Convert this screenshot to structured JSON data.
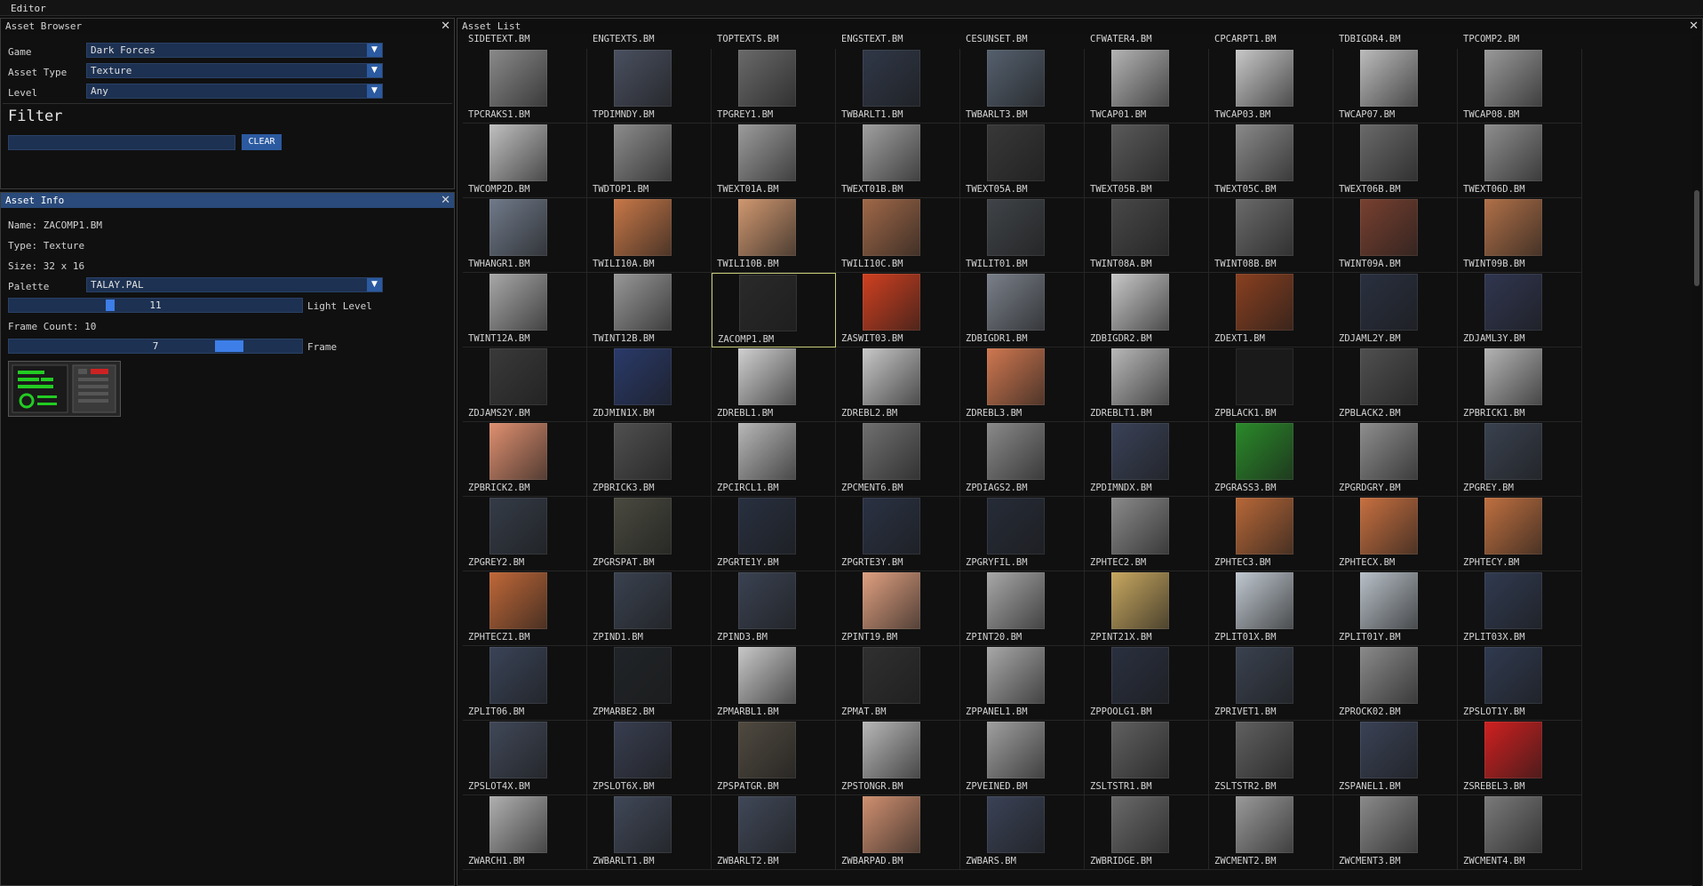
{
  "window": {
    "title": "Editor"
  },
  "asset_browser": {
    "title": "Asset Browser",
    "rows": [
      {
        "label": "Game",
        "value": "Dark Forces"
      },
      {
        "label": "Asset Type",
        "value": "Texture"
      },
      {
        "label": "Level",
        "value": "Any"
      }
    ],
    "filter_heading": "Filter",
    "filter_value": "",
    "clear_label": "CLEAR"
  },
  "asset_info": {
    "title": "Asset Info",
    "name_line": "Name: ZACOMP1.BM",
    "type_line": "Type: Texture",
    "size_line": "Size: 32 x 16",
    "palette_label": "Palette",
    "palette_value": "TALAY.PAL",
    "light_level": {
      "label": "Light Level",
      "value": "11",
      "fraction": 0.34
    },
    "frame_count_line": "Frame Count: 10",
    "frame": {
      "label": "Frame",
      "value": "7",
      "fraction": 0.78
    }
  },
  "asset_list": {
    "title": "Asset List",
    "top_labels": [
      "SIDETEXT.BM",
      "ENGTEXTS.BM",
      "TOPTEXTS.BM",
      "ENGSTEXT.BM",
      "CESUNSET.BM",
      "CFWATER4.BM",
      "CPCARPT1.BM",
      "TDBIGDR4.BM",
      "TPCOMP2.BM"
    ],
    "selected": "ZACOMP1.BM",
    "items": [
      {
        "name": "TPCRAKS1.BM",
        "c": "#8a8a8a"
      },
      {
        "name": "TPDIMNDY.BM",
        "c": "#4a5060"
      },
      {
        "name": "TPGREY1.BM",
        "c": "#6a6a6a"
      },
      {
        "name": "TWBARLT1.BM",
        "c": "#303848"
      },
      {
        "name": "TWBARLT3.BM",
        "c": "#55606e"
      },
      {
        "name": "TWCAP01.BM",
        "c": "#b4b4b4"
      },
      {
        "name": "TWCAP03.BM",
        "c": "#c8c8c8"
      },
      {
        "name": "TWCAP07.BM",
        "c": "#bcbcbc"
      },
      {
        "name": "TWCAP08.BM",
        "c": "#9a9a9a"
      },
      {
        "name": "TWCOMP2D.BM",
        "c": "#c0c0c0"
      },
      {
        "name": "TWDTOP1.BM",
        "c": "#8c8c8c"
      },
      {
        "name": "TWEXT01A.BM",
        "c": "#9c9c9c"
      },
      {
        "name": "TWEXT01B.BM",
        "c": "#a0a0a0"
      },
      {
        "name": "TWEXT05A.BM",
        "c": "#383838"
      },
      {
        "name": "TWEXT05B.BM",
        "c": "#5a5a5a"
      },
      {
        "name": "TWEXT05C.BM",
        "c": "#8a8a8a"
      },
      {
        "name": "TWEXT06B.BM",
        "c": "#6a6a6a"
      },
      {
        "name": "TWEXT06D.BM",
        "c": "#8e8e8e"
      },
      {
        "name": "TWHANGR1.BM",
        "c": "#707a8a"
      },
      {
        "name": "TWILI10A.BM",
        "c": "#c87848"
      },
      {
        "name": "TWILI10B.BM",
        "c": "#d09870"
      },
      {
        "name": "TWILI10C.BM",
        "c": "#a06848"
      },
      {
        "name": "TWILIT01.BM",
        "c": "#404448"
      },
      {
        "name": "TWINT08A.BM",
        "c": "#484848"
      },
      {
        "name": "TWINT08B.BM",
        "c": "#6a6a6a"
      },
      {
        "name": "TWINT09A.BM",
        "c": "#784030"
      },
      {
        "name": "TWINT09B.BM",
        "c": "#b07048"
      },
      {
        "name": "TWINT12A.BM",
        "c": "#a8a8a8"
      },
      {
        "name": "TWINT12B.BM",
        "c": "#989898"
      },
      {
        "name": "ZACOMP1.BM",
        "c": "#2a2a2a"
      },
      {
        "name": "ZASWIT03.BM",
        "c": "#d04020"
      },
      {
        "name": "ZDBIGDR1.BM",
        "c": "#7a808a"
      },
      {
        "name": "ZDBIGDR2.BM",
        "c": "#c8c8c8"
      },
      {
        "name": "ZDEXT1.BM",
        "c": "#8a4020"
      },
      {
        "name": "ZDJAML2Y.BM",
        "c": "#2a3040"
      },
      {
        "name": "ZDJAML3Y.BM",
        "c": "#303650"
      },
      {
        "name": "ZDJAMS2Y.BM",
        "c": "#3a3a3a"
      },
      {
        "name": "ZDJMIN1X.BM",
        "c": "#2a3a6a"
      },
      {
        "name": "ZDREBL1.BM",
        "c": "#d0d0d0"
      },
      {
        "name": "ZDREBL2.BM",
        "c": "#c8c8c8"
      },
      {
        "name": "ZDREBL3.BM",
        "c": "#d07850"
      },
      {
        "name": "ZDREBLT1.BM",
        "c": "#b8b8b8"
      },
      {
        "name": "ZPBLACK1.BM",
        "c": "#1a1a1a"
      },
      {
        "name": "ZPBLACK2.BM",
        "c": "#505050"
      },
      {
        "name": "ZPBRICK1.BM",
        "c": "#b4b4b4"
      },
      {
        "name": "ZPBRICK2.BM",
        "c": "#e09070"
      },
      {
        "name": "ZPBRICK3.BM",
        "c": "#505050"
      },
      {
        "name": "ZPCIRCL1.BM",
        "c": "#b8b8b8"
      },
      {
        "name": "ZPCMENT6.BM",
        "c": "#707070"
      },
      {
        "name": "ZPDIAGS2.BM",
        "c": "#8a8a8a"
      },
      {
        "name": "ZPDIMNDX.BM",
        "c": "#3a4258"
      },
      {
        "name": "ZPGRASS3.BM",
        "c": "#2a8a2a"
      },
      {
        "name": "ZPGRDGRY.BM",
        "c": "#8e8e8e"
      },
      {
        "name": "ZPGREY.BM",
        "c": "#3a4250"
      },
      {
        "name": "ZPGREY2.BM",
        "c": "#353c48"
      },
      {
        "name": "ZPGRSPAT.BM",
        "c": "#4a4a40"
      },
      {
        "name": "ZPGRTE1Y.BM",
        "c": "#283040"
      },
      {
        "name": "ZPGRTE3Y.BM",
        "c": "#2a3244"
      },
      {
        "name": "ZPGRYFIL.BM",
        "c": "#262c38"
      },
      {
        "name": "ZPHTEC2.BM",
        "c": "#8a8a8a"
      },
      {
        "name": "ZPHTEC3.BM",
        "c": "#b86838"
      },
      {
        "name": "ZPHTECX.BM",
        "c": "#c87040"
      },
      {
        "name": "ZPHTECY.BM",
        "c": "#c07040"
      },
      {
        "name": "ZPHTECZ1.BM",
        "c": "#c06838"
      },
      {
        "name": "ZPIND1.BM",
        "c": "#3a4250"
      },
      {
        "name": "ZPIND3.BM",
        "c": "#3a4252"
      },
      {
        "name": "ZPINT19.BM",
        "c": "#e0a080"
      },
      {
        "name": "ZPINT20.BM",
        "c": "#a8a8a8"
      },
      {
        "name": "ZPINT21X.BM",
        "c": "#c8a860"
      },
      {
        "name": "ZPLIT01X.BM",
        "c": "#c0c8d0"
      },
      {
        "name": "ZPLIT01Y.BM",
        "c": "#b8c0c8"
      },
      {
        "name": "ZPLIT03X.BM",
        "c": "#303a50"
      },
      {
        "name": "ZPLIT06.BM",
        "c": "#3a4458"
      },
      {
        "name": "ZPMARBE2.BM",
        "c": "#202428"
      },
      {
        "name": "ZPMARBL1.BM",
        "c": "#c8c8c8"
      },
      {
        "name": "ZPMAT.BM",
        "c": "#303030"
      },
      {
        "name": "ZPPANEL1.BM",
        "c": "#a8a8a8"
      },
      {
        "name": "ZPPOOLG1.BM",
        "c": "#2a3040"
      },
      {
        "name": "ZPRIVET1.BM",
        "c": "#3a4250"
      },
      {
        "name": "ZPROCK02.BM",
        "c": "#8a8a8a"
      },
      {
        "name": "ZPSLOT1Y.BM",
        "c": "#303a50"
      },
      {
        "name": "ZPSLOT4X.BM",
        "c": "#404858"
      },
      {
        "name": "ZPSLOT6X.BM",
        "c": "#383e50"
      },
      {
        "name": "ZPSPATGR.BM",
        "c": "#504a40"
      },
      {
        "name": "ZPSTONGR.BM",
        "c": "#b8b8b8"
      },
      {
        "name": "ZPVEINED.BM",
        "c": "#a0a0a0"
      },
      {
        "name": "ZSLTSTR1.BM",
        "c": "#606060"
      },
      {
        "name": "ZSLTSTR2.BM",
        "c": "#606060"
      },
      {
        "name": "ZSPANEL1.BM",
        "c": "#3a4256"
      },
      {
        "name": "ZSREBEL3.BM",
        "c": "#d02020"
      },
      {
        "name": "ZWARCH1.BM",
        "c": "#b0b0b0"
      },
      {
        "name": "ZWBARLT1.BM",
        "c": "#404858"
      },
      {
        "name": "ZWBARLT2.BM",
        "c": "#404858"
      },
      {
        "name": "ZWBARPAD.BM",
        "c": "#d09070"
      },
      {
        "name": "ZWBARS.BM",
        "c": "#3a4256"
      },
      {
        "name": "ZWBRIDGE.BM",
        "c": "#6a6a6a"
      },
      {
        "name": "ZWCMENT2.BM",
        "c": "#9a9a9a"
      },
      {
        "name": "ZWCMENT3.BM",
        "c": "#8a8a8a"
      },
      {
        "name": "ZWCMENT4.BM",
        "c": "#7a7a7a"
      }
    ]
  },
  "colors": {
    "accent": "#2b5aa0",
    "active_title": "#294a7a",
    "field_bg": "#1d3152",
    "selection": "#c8cf7a"
  }
}
